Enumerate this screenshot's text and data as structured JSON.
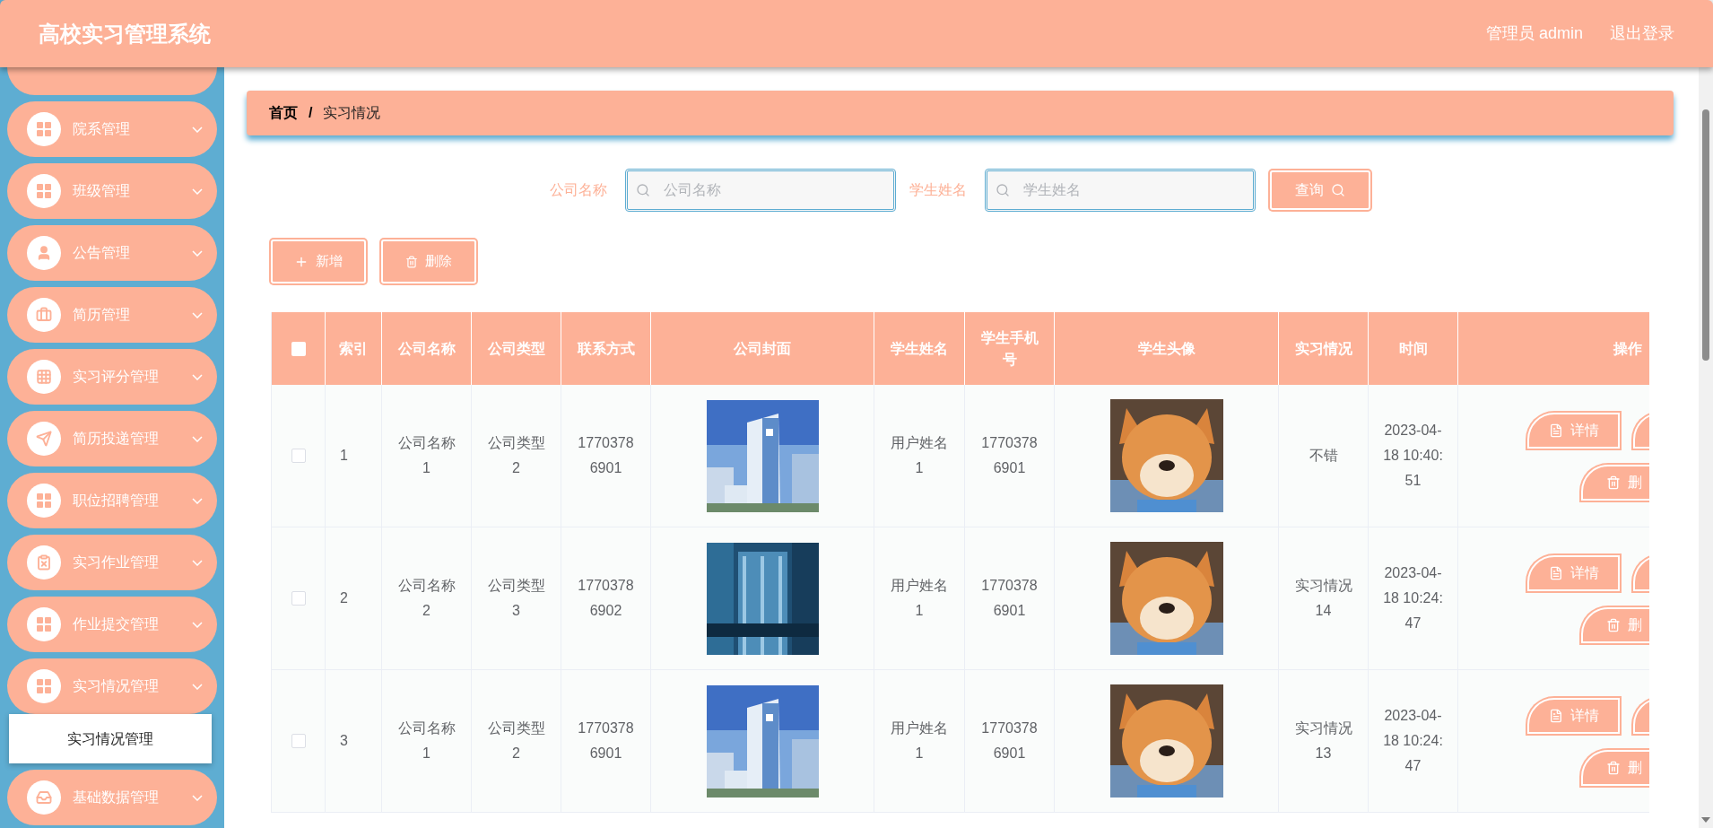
{
  "header": {
    "title": "高校实习管理系统",
    "user": "管理员 admin",
    "logout": "退出登录"
  },
  "sidebar": {
    "items": [
      {
        "label": "院系管理"
      },
      {
        "label": "班级管理"
      },
      {
        "label": "公告管理"
      },
      {
        "label": "简历管理"
      },
      {
        "label": "实习评分管理"
      },
      {
        "label": "简历投递管理"
      },
      {
        "label": "职位招聘管理"
      },
      {
        "label": "实习作业管理"
      },
      {
        "label": "作业提交管理"
      },
      {
        "label": "实习情况管理",
        "children": [
          {
            "label": "实习情况管理",
            "selected": true
          }
        ]
      },
      {
        "label": "基础数据管理"
      }
    ]
  },
  "breadcrumb": {
    "items": [
      "首页",
      "实习情况"
    ],
    "separator": "/"
  },
  "search": {
    "fields": [
      {
        "label": "公司名称",
        "placeholder": "公司名称"
      },
      {
        "label": "学生姓名",
        "placeholder": "学生姓名"
      }
    ],
    "button": "查询"
  },
  "actions": [
    {
      "kind": "add",
      "label": "新增"
    },
    {
      "kind": "delete",
      "label": "删除"
    }
  ],
  "table": {
    "header_checked": false,
    "columns": [
      "索引",
      "公司名称",
      "公司类型",
      "联系方式",
      "公司封面",
      "学生姓名",
      "学生手机号",
      "学生头像",
      "实习情况",
      "时间",
      "操作"
    ],
    "rows": [
      {
        "checked": false,
        "index": "1",
        "company": "公司名称1",
        "type": "公司类型2",
        "contact": "17703786901",
        "student": "用户姓名1",
        "phone": "17703786901",
        "status": "不错",
        "time": "2023-04-18 10:40:51",
        "ops": [
          {
            "kind": "detail",
            "label": "详情"
          },
          {
            "kind": "edit"
          },
          {
            "kind": "delete",
            "label": "删"
          }
        ]
      },
      {
        "checked": false,
        "index": "2",
        "company": "公司名称2",
        "type": "公司类型3",
        "contact": "17703786902",
        "student": "用户姓名1",
        "phone": "17703786901",
        "status": "实习情况14",
        "time": "2023-04-18 10:24:47",
        "ops": [
          {
            "kind": "detail",
            "label": "详情"
          },
          {
            "kind": "edit"
          },
          {
            "kind": "delete",
            "label": "删"
          }
        ]
      },
      {
        "checked": false,
        "index": "3",
        "company": "公司名称1",
        "type": "公司类型2",
        "contact": "17703786901",
        "student": "用户姓名1",
        "phone": "17703786901",
        "status": "实习情况13",
        "time": "2023-04-18 10:24:47",
        "ops": [
          {
            "kind": "detail",
            "label": "详情"
          },
          {
            "kind": "edit"
          },
          {
            "kind": "delete",
            "label": "删"
          }
        ]
      }
    ]
  }
}
